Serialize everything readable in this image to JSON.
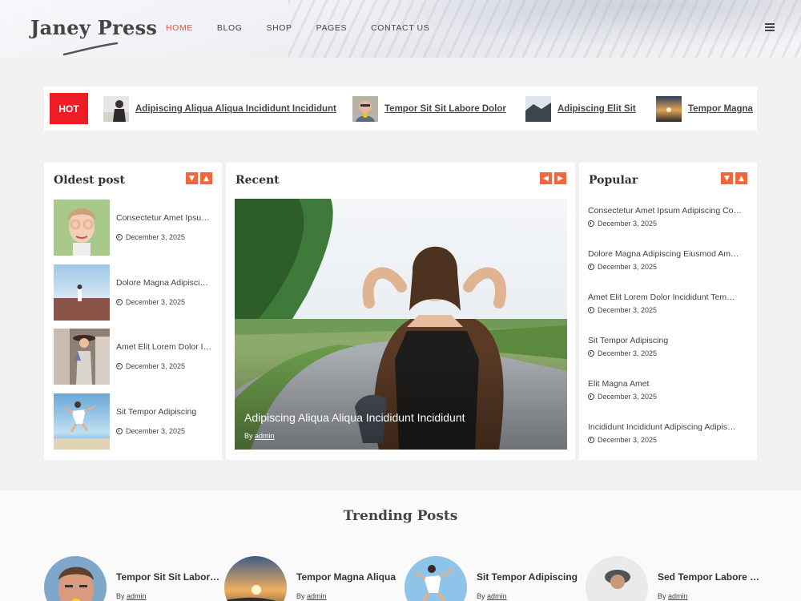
{
  "site": {
    "title": "Janey Press"
  },
  "nav": {
    "items": [
      {
        "label": "HOME",
        "active": true
      },
      {
        "label": "BLOG"
      },
      {
        "label": "SHOP"
      },
      {
        "label": "PAGES"
      },
      {
        "label": "CONTACT US"
      }
    ],
    "menu_icon": "hamburger-menu-icon"
  },
  "ticker": {
    "badge": "HOT",
    "items": [
      {
        "title": "Adipiscing Aliqua Aliqua Incididunt Incididunt"
      },
      {
        "title": "Tempor Sit Sit Labore Dolor"
      },
      {
        "title": "Adipiscing Elit Sit"
      },
      {
        "title": "Tempor Magna"
      }
    ]
  },
  "oldest": {
    "title": "Oldest post",
    "items": [
      {
        "title": "Consectetur Amet Ipsum Adipiscing",
        "date": "December 3, 2025"
      },
      {
        "title": "Dolore Magna Adipiscing Eiusmod",
        "date": "December 3, 2025"
      },
      {
        "title": "Amet Elit Lorem Dolor Incididunt",
        "date": "December 3, 2025"
      },
      {
        "title": "Sit Tempor Adipiscing",
        "date": "December 3, 2025"
      }
    ]
  },
  "recent": {
    "title": "Recent",
    "caption": "Adipiscing Aliqua Aliqua Incididunt Incididunt",
    "by_label": "By",
    "author": "admin"
  },
  "popular": {
    "title": "Popular",
    "items": [
      {
        "title": "Consectetur Amet Ipsum Adipiscing Co…",
        "date": "December 3, 2025"
      },
      {
        "title": "Dolore Magna Adipiscing Eiusmod Am…",
        "date": "December 3, 2025"
      },
      {
        "title": "Amet Elit Lorem Dolor Incididunt Tem…",
        "date": "December 3, 2025"
      },
      {
        "title": "Sit Tempor Adipiscing",
        "date": "December 3, 2025"
      },
      {
        "title": "Elit Magna Amet",
        "date": "December 3, 2025"
      },
      {
        "title": "Incididunt Incididunt Adipiscing Adipis…",
        "date": "December 3, 2025"
      }
    ]
  },
  "trending": {
    "title": "Trending Posts",
    "items": [
      {
        "title": "Tempor Sit Sit Labore Dolor",
        "by": "By",
        "author": "admin"
      },
      {
        "title": "Tempor Magna Aliqua",
        "by": "By",
        "author": "admin"
      },
      {
        "title": "Sit Tempor Adipiscing",
        "by": "By",
        "author": "admin"
      },
      {
        "title": "Sed Tempor Labore Dolor",
        "by": "By",
        "author": "admin"
      }
    ]
  },
  "colors": {
    "accent": "#e8523a",
    "hot": "#ee1c25",
    "arrow": "#f0673d"
  }
}
